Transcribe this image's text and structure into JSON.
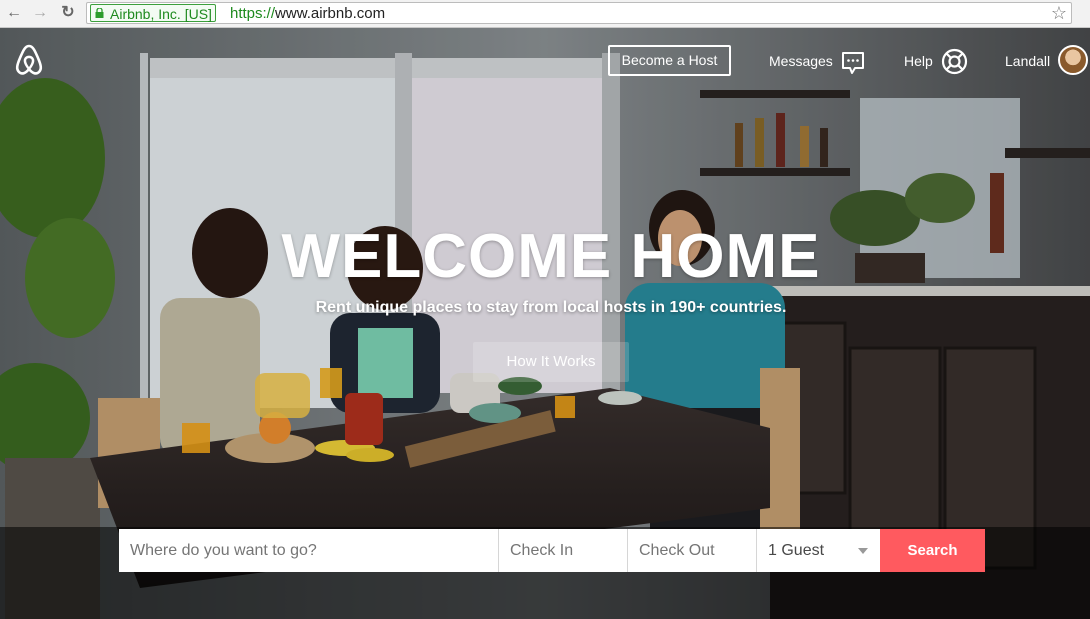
{
  "browser": {
    "ev_badge": "Airbnb, Inc. [US]",
    "url_scheme": "https://",
    "url_host": "www.airbnb.com"
  },
  "header": {
    "become_host": "Become a Host",
    "messages": "Messages",
    "help": "Help",
    "user_name": "Landall"
  },
  "hero": {
    "title": "WELCOME HOME",
    "subtitle": "Rent unique places to stay from local hosts in 190+ countries.",
    "how_it_works": "How It Works"
  },
  "search": {
    "where_placeholder": "Where do you want to go?",
    "checkin_placeholder": "Check In",
    "checkout_placeholder": "Check Out",
    "guests_value": "1 Guest",
    "button": "Search"
  },
  "colors": {
    "brand": "#ff5a5f",
    "secure_green": "#1e8a1e"
  }
}
